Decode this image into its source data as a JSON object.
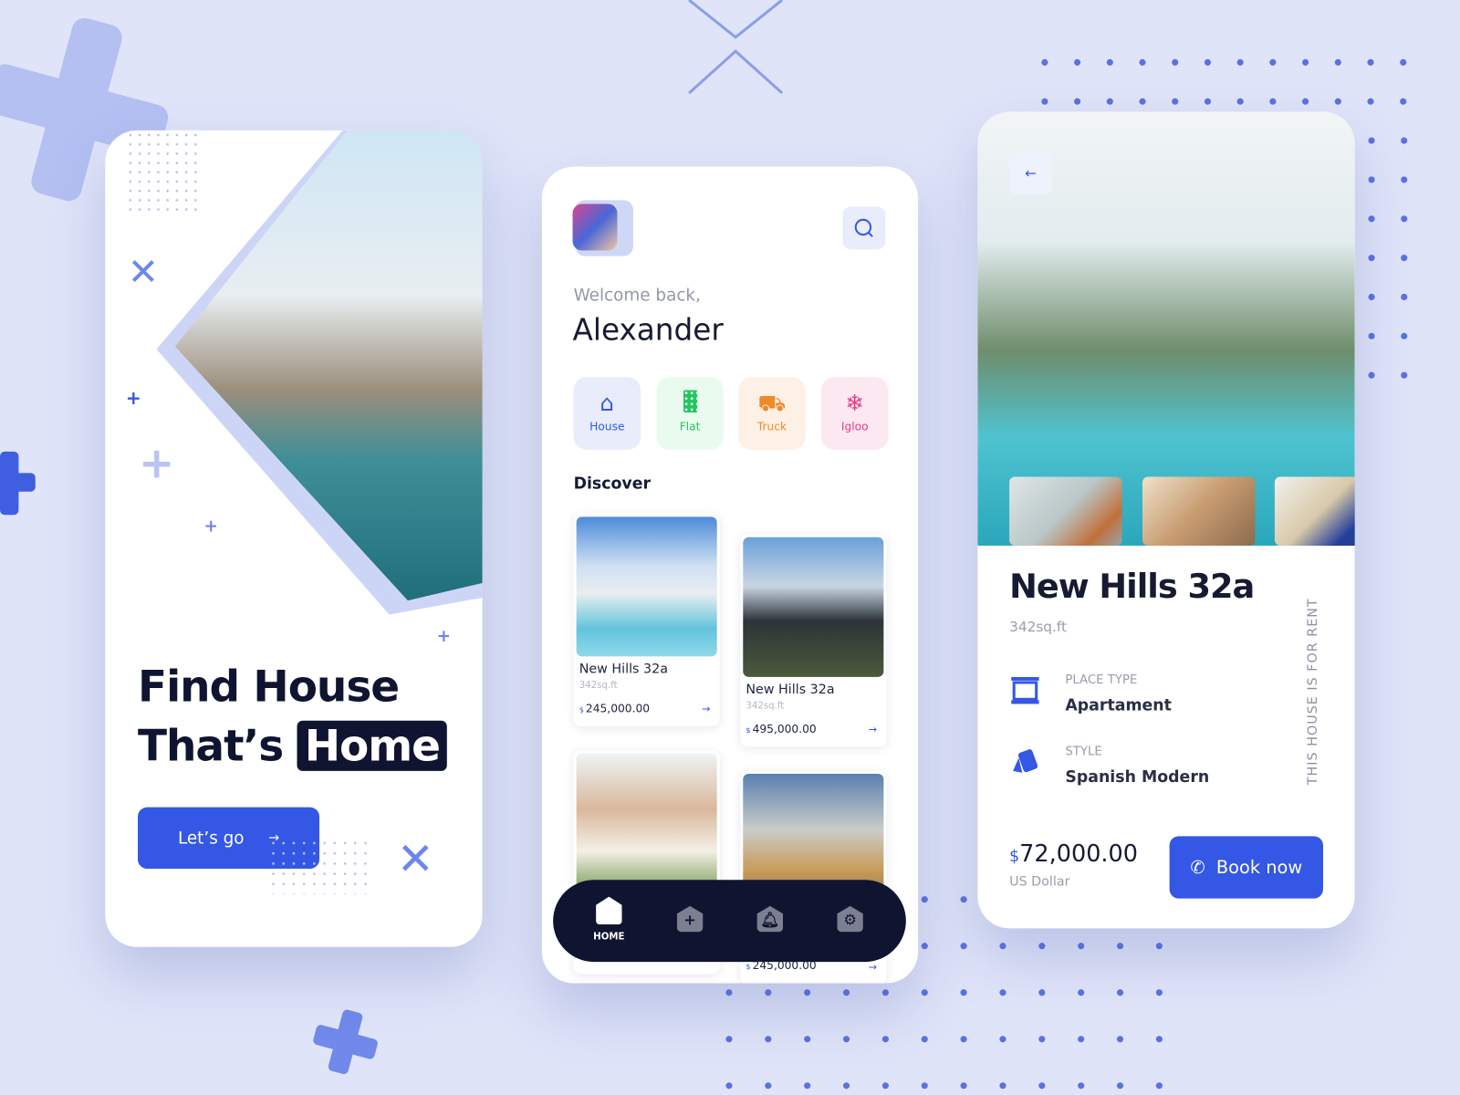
{
  "colors": {
    "accent": "#3457e5",
    "dark": "#0f1430",
    "background": "#dfe4f9"
  },
  "onboarding": {
    "headline_line1": "Find House",
    "headline_prefix": "That’s",
    "headline_highlight": "Home",
    "cta_label": "Let’s go",
    "cta_icon": "arrow-right-icon"
  },
  "home": {
    "welcome": "Welcome back,",
    "user_name": "Alexander",
    "categories": [
      {
        "label": "House",
        "icon": "house-icon",
        "color": "#3457e5",
        "bg": "#e8ecfb"
      },
      {
        "label": "Flat",
        "icon": "building-icon",
        "color": "#22c55e",
        "bg": "#e9fbef"
      },
      {
        "label": "Truck",
        "icon": "truck-icon",
        "color": "#ee8a2a",
        "bg": "#fdf1e6"
      },
      {
        "label": "Igloo",
        "icon": "snowflake-icon",
        "color": "#e83e8c",
        "bg": "#fce8f1"
      }
    ],
    "section_title": "Discover",
    "listings": [
      {
        "title": "New Hills 32a",
        "area": "342sq.ft",
        "currency": "$",
        "price": "245,000.00"
      },
      {
        "title": "New Hills 32a",
        "area": "342sq.ft",
        "currency": "$",
        "price": "495,000.00"
      },
      {
        "currency": "$",
        "price": "245,000.00"
      }
    ],
    "nav": {
      "home_label": "HOME",
      "items": [
        "home-icon",
        "add-icon",
        "bell-icon",
        "settings-icon"
      ]
    }
  },
  "detail": {
    "title": "New Hills 32a",
    "area": "342sq.ft",
    "place_type_label": "PLACE TYPE",
    "place_type_value": "Apartament",
    "style_label": "STYLE",
    "style_value": "Spanish Modern",
    "vertical_note": "THIS HOUSE IS FOR RENT",
    "currency": "$",
    "price": "72,000.00",
    "price_unit": "US Dollar",
    "book_label": "Book now"
  }
}
